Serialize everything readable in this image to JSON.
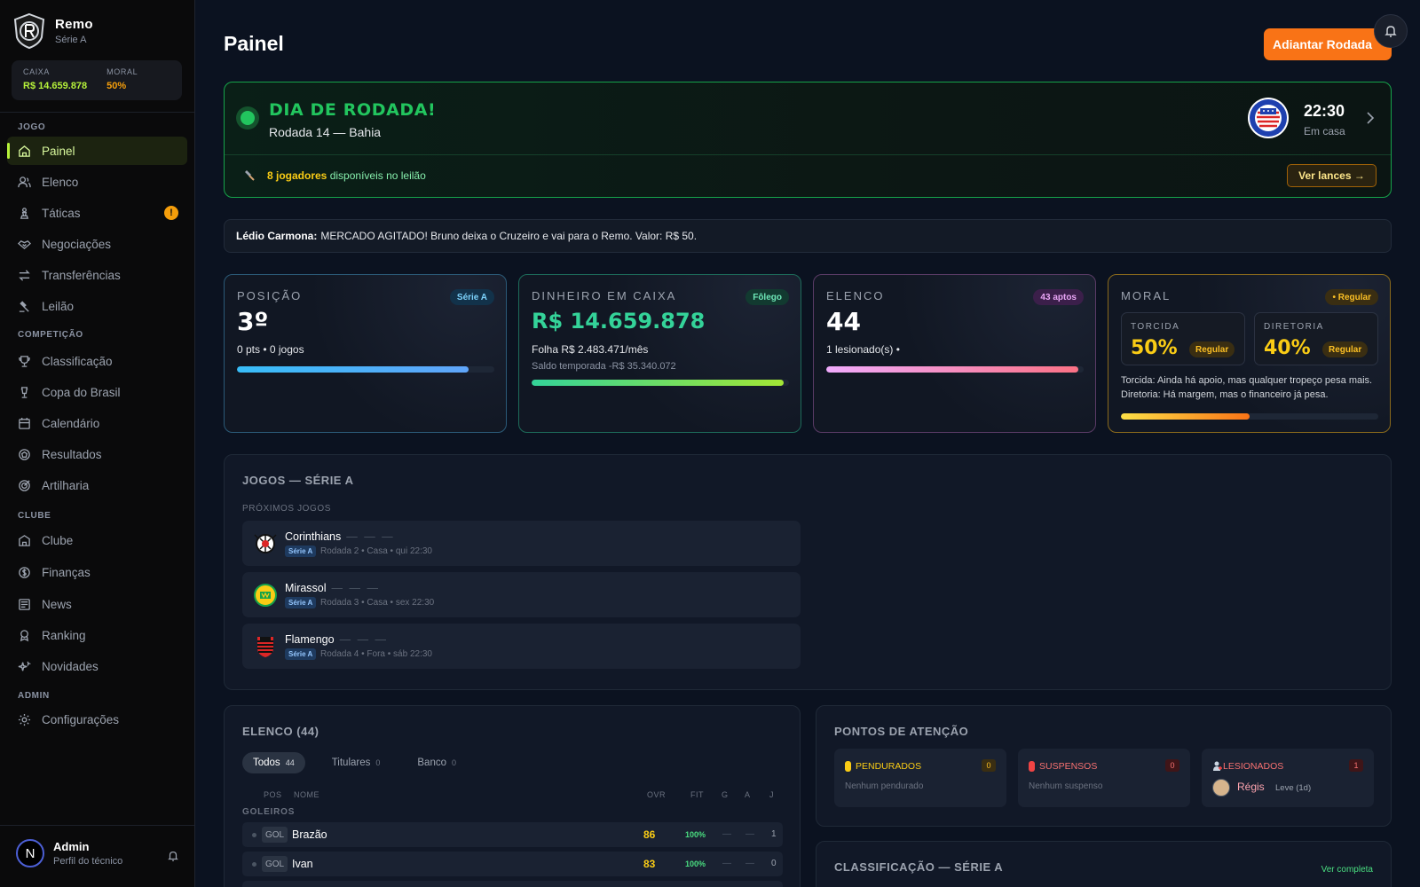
{
  "club": {
    "name": "Remo",
    "division": "Série A"
  },
  "sidebox": {
    "cash_label": "CAIXA",
    "cash_value": "R$ 14.659.878",
    "morale_label": "MORAL",
    "morale_value": "50%"
  },
  "nav": {
    "section_game": "JOGO",
    "section_competition": "COMPETIÇÃO",
    "section_club": "CLUBE",
    "section_admin": "ADMIN",
    "items": {
      "painel": "Painel",
      "elenco": "Elenco",
      "taticas": "Táticas",
      "negociacoes": "Negociações",
      "transferencias": "Transferências",
      "leilao": "Leilão",
      "classificacao": "Classificação",
      "copa": "Copa do Brasil",
      "calendario": "Calendário",
      "resultados": "Resultados",
      "artilharia": "Artilharia",
      "clube": "Clube",
      "financas": "Finanças",
      "news": "News",
      "ranking": "Ranking",
      "novidades": "Novidades",
      "configuracoes": "Configurações"
    },
    "taticas_badge": "!"
  },
  "user": {
    "initial": "N",
    "name": "Admin",
    "subtitle": "Perfil do técnico"
  },
  "header": {
    "title": "Painel",
    "advance_button": "Adiantar Rodada"
  },
  "matchday": {
    "title": "DIA DE RODADA!",
    "subtitle": "Rodada 14 — Bahia",
    "time": "22:30",
    "venue": "Em casa",
    "auction_count": "8 jogadores",
    "auction_text": "disponíveis no leilão",
    "bids_button": "Ver lances →"
  },
  "news": {
    "author": "Lédio Carmona:",
    "text": "MERCADO AGITADO! Bruno deixa o Cruzeiro e vai para o Remo. Valor: R$ 50."
  },
  "stats": {
    "position": {
      "label": "POSIÇÃO",
      "badge": "Série A",
      "value": "3º",
      "detail": "0 pts • 0 jogos",
      "progress": 0.9
    },
    "cash": {
      "label": "DINHEIRO EM CAIXA",
      "badge": "Fôlego",
      "value": "R$ 14.659.878",
      "detail": "Folha R$ 2.483.471/mês",
      "detail2": "Saldo temporada -R$ 35.340.072",
      "progress": 0.98
    },
    "squad": {
      "label": "ELENCO",
      "badge": "43 aptos",
      "value": "44",
      "detail": "1 lesionado(s) •",
      "progress": 0.98
    },
    "morale": {
      "label": "MORAL",
      "badge": "• Regular",
      "fans_label": "TORCIDA",
      "fans_value": "50%",
      "fans_status": "Regular",
      "board_label": "DIRETORIA",
      "board_value": "40%",
      "board_status": "Regular",
      "fans_text": "Torcida: Ainda há apoio, mas qualquer tropeço pesa mais.",
      "board_text": "Diretoria: Há margem, mas o financeiro já pesa.",
      "progress": 0.5
    }
  },
  "games": {
    "title": "JOGOS — SÉRIE A",
    "upcoming_label": "PRÓXIMOS JOGOS",
    "list": [
      {
        "team": "Corinthians",
        "dash": "— — —",
        "tag": "Série A",
        "meta": "Rodada 2 • Casa • qui 22:30"
      },
      {
        "team": "Mirassol",
        "dash": "— — —",
        "tag": "Série A",
        "meta": "Rodada 3 • Casa • sex 22:30"
      },
      {
        "team": "Flamengo",
        "dash": "— — —",
        "tag": "Série A",
        "meta": "Rodada 4 • Fora • sáb 22:30"
      }
    ]
  },
  "squad": {
    "title": "ELENCO (44)",
    "tabs": [
      {
        "label": "Todos",
        "count": "44"
      },
      {
        "label": "Titulares",
        "count": "0"
      },
      {
        "label": "Banco",
        "count": "0"
      }
    ],
    "headers": {
      "pos": "POS",
      "name": "NOME",
      "ovr": "OVR",
      "fit": "FIT",
      "g": "G",
      "a": "A",
      "j": "J"
    },
    "group": "GOLEIROS",
    "players": [
      {
        "pos": "GOL",
        "name": "Brazão",
        "ovr": "86",
        "fit": "100%",
        "g": "—",
        "a": "—",
        "j": "1"
      },
      {
        "pos": "GOL",
        "name": "Ivan",
        "ovr": "83",
        "fit": "100%",
        "g": "—",
        "a": "—",
        "j": "0"
      }
    ]
  },
  "attention": {
    "title": "PONTOS DE ATENÇÃO",
    "suspended_card": {
      "label": "PENDURADOS",
      "count": "0",
      "empty": "Nenhum pendurado"
    },
    "suspended": {
      "label": "SUSPENSOS",
      "count": "0",
      "empty": "Nenhum suspenso"
    },
    "injured": {
      "label": "LESIONADOS",
      "count": "1",
      "player": "Régis",
      "status": "Leve (1d)"
    }
  },
  "classification": {
    "title": "CLASSIFICAÇÃO — SÉRIE A",
    "link": "Ver completa"
  },
  "colors": {
    "accent": "#b6f23a",
    "orange": "#f97316",
    "green": "#22c55e",
    "yellow": "#facc15"
  }
}
